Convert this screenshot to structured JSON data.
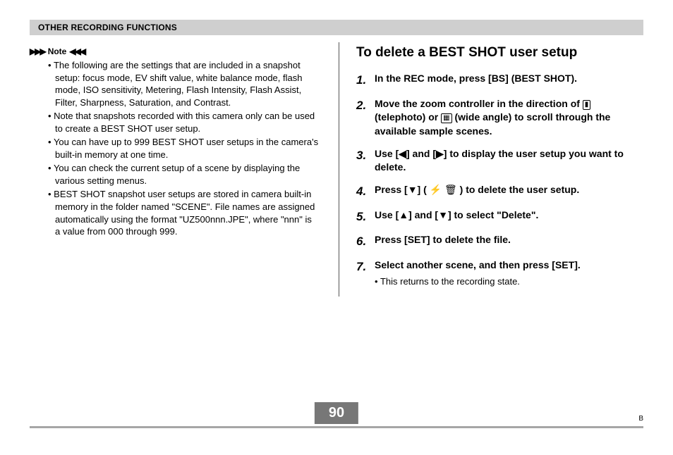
{
  "section_header": "OTHER RECORDING FUNCTIONS",
  "note": {
    "label": "Note",
    "items": [
      "The following are the settings that are included in a snapshot setup: focus mode, EV shift value, white balance mode, flash mode, ISO sensitivity, Metering, Flash Intensity, Flash Assist, Filter, Sharpness, Saturation, and Contrast.",
      "Note that snapshots recorded with this camera only can be used to create a BEST SHOT user setup.",
      "You can have up to 999 BEST SHOT user setups in the camera's built-in memory at one time.",
      "You can check the current setup of a scene by displaying the various setting menus.",
      "BEST SHOT snapshot user setups are stored in camera built-in memory in the folder named \"SCENE\". File names are assigned automatically using the format \"UZ500nnn.JPE\", where \"nnn\" is a value from 000 through 999."
    ]
  },
  "right": {
    "title": "To delete a BEST SHOT user setup",
    "steps": [
      {
        "num": "1.",
        "body": "In the REC mode, press [BS] (BEST SHOT)."
      },
      {
        "num": "2.",
        "body_pre": "Move the zoom controller in the direction of ",
        "icon1": "telephoto-icon",
        "body_mid1": " (telephoto) or ",
        "icon2": "wide-angle-icon",
        "body_post": " (wide angle) to scroll through the available sample scenes."
      },
      {
        "num": "3.",
        "body": "Use [◀] and [▶] to display the user setup you want to delete."
      },
      {
        "num": "4.",
        "body_pre": "Press [▼] ( ",
        "icon3": "flash-trash-icon",
        "body_post2": " ) to delete the user setup."
      },
      {
        "num": "5.",
        "body": "Use [▲] and [▼] to select \"Delete\"."
      },
      {
        "num": "6.",
        "body": "Press [SET] to delete the file."
      },
      {
        "num": "7.",
        "body": "Select another scene, and then press [SET].",
        "sub": "This returns to the recording state."
      }
    ]
  },
  "footer": {
    "page": "90",
    "right": "B"
  },
  "chart_data": null
}
